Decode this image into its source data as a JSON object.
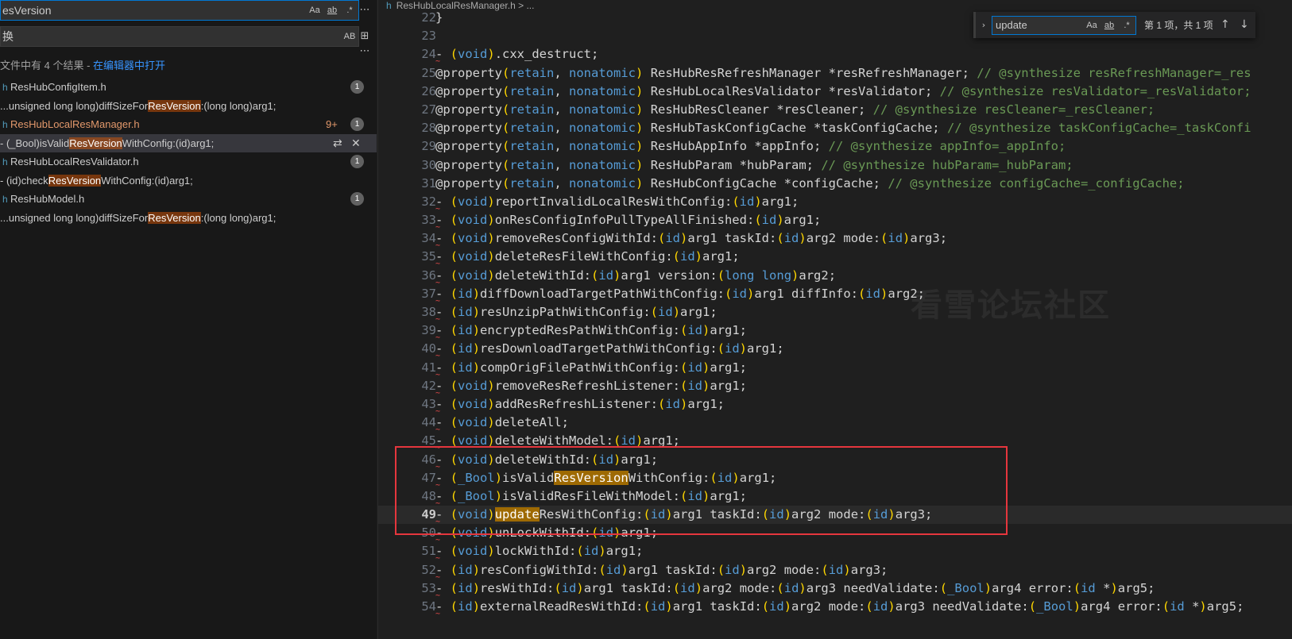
{
  "search": {
    "query": "esVersion",
    "replace_placeholder": "换",
    "opt_case": "Aa",
    "opt_word": "ab",
    "opt_regex": ".*",
    "opt_preserve_case": "AB",
    "summary_prefix": "文件中有 4 个结果 - ",
    "summary_link": "在编辑器中打开",
    "results": [
      {
        "file": "ResHubConfigItem.h",
        "count": "1",
        "matches": [
          {
            "before": "...unsigned long long)diffSizeFor",
            "match": "ResVersion",
            "after": ":(long long)arg1;"
          }
        ]
      },
      {
        "file": "ResHubLocalResManager.h",
        "count": "1",
        "modified": "9+",
        "matches": [
          {
            "before": "- (_Bool)isValid",
            "match": "ResVersion",
            "after": "WithConfig:(id)arg1;"
          }
        ]
      },
      {
        "file": "ResHubLocalResValidator.h",
        "count": "1",
        "matches": [
          {
            "before": "- (id)check",
            "match": "ResVersion",
            "after": "WithConfig:(id)arg1;"
          }
        ]
      },
      {
        "file": "ResHubModel.h",
        "count": "1",
        "matches": [
          {
            "before": "...unsigned long long)diffSizeFor",
            "match": "ResVersion",
            "after": ":(long long)arg1;"
          }
        ]
      }
    ]
  },
  "editor": {
    "breadcrumb_file": "ResHubLocalResManager.h",
    "breadcrumb_rest": " > ...",
    "find": {
      "query": "update",
      "count": "第 1 项，共 1 项",
      "opt_case": "Aa",
      "opt_word": "ab",
      "opt_regex": ".*"
    },
    "lines": [
      {
        "n": "22",
        "text": "}"
      },
      {
        "n": "23",
        "text": ""
      },
      {
        "n": "24",
        "text": "- (void).cxx_destruct;"
      },
      {
        "n": "25",
        "text": "@property(retain, nonatomic) ResHubResRefreshManager *resRefreshManager; // @synthesize resRefreshManager=_res"
      },
      {
        "n": "26",
        "text": "@property(retain, nonatomic) ResHubLocalResValidator *resValidator; // @synthesize resValidator=_resValidator;"
      },
      {
        "n": "27",
        "text": "@property(retain, nonatomic) ResHubResCleaner *resCleaner; // @synthesize resCleaner=_resCleaner;"
      },
      {
        "n": "28",
        "text": "@property(retain, nonatomic) ResHubTaskConfigCache *taskConfigCache; // @synthesize taskConfigCache=_taskConfi"
      },
      {
        "n": "29",
        "text": "@property(retain, nonatomic) ResHubAppInfo *appInfo; // @synthesize appInfo=_appInfo;"
      },
      {
        "n": "30",
        "text": "@property(retain, nonatomic) ResHubParam *hubParam; // @synthesize hubParam=_hubParam;"
      },
      {
        "n": "31",
        "text": "@property(retain, nonatomic) ResHubConfigCache *configCache; // @synthesize configCache=_configCache;"
      },
      {
        "n": "32",
        "text": "- (void)reportInvalidLocalResWithConfig:(id)arg1;"
      },
      {
        "n": "33",
        "text": "- (void)onResConfigInfoPullTypeAllFinished:(id)arg1;"
      },
      {
        "n": "34",
        "text": "- (void)removeResConfigWithId:(id)arg1 taskId:(id)arg2 mode:(id)arg3;"
      },
      {
        "n": "35",
        "text": "- (void)deleteResFileWithConfig:(id)arg1;"
      },
      {
        "n": "36",
        "text": "- (void)deleteWithId:(id)arg1 version:(long long)arg2;"
      },
      {
        "n": "37",
        "text": "- (id)diffDownloadTargetPathWithConfig:(id)arg1 diffInfo:(id)arg2;"
      },
      {
        "n": "38",
        "text": "- (id)resUnzipPathWithConfig:(id)arg1;"
      },
      {
        "n": "39",
        "text": "- (id)encryptedResPathWithConfig:(id)arg1;"
      },
      {
        "n": "40",
        "text": "- (id)resDownloadTargetPathWithConfig:(id)arg1;"
      },
      {
        "n": "41",
        "text": "- (id)compOrigFilePathWithConfig:(id)arg1;"
      },
      {
        "n": "42",
        "text": "- (void)removeResRefreshListener:(id)arg1;"
      },
      {
        "n": "43",
        "text": "- (void)addResRefreshListener:(id)arg1;"
      },
      {
        "n": "44",
        "text": "- (void)deleteAll;"
      },
      {
        "n": "45",
        "text": "- (void)deleteWithModel:(id)arg1;"
      },
      {
        "n": "46",
        "text": "- (void)deleteWithId:(id)arg1;"
      },
      {
        "n": "47",
        "text": "- (_Bool)isValidResVersionWithConfig:(id)arg1;"
      },
      {
        "n": "48",
        "text": "- (_Bool)isValidResFileWithModel:(id)arg1;"
      },
      {
        "n": "49",
        "text": "- (void)updateResWithConfig:(id)arg1 taskId:(id)arg2 mode:(id)arg3;"
      },
      {
        "n": "50",
        "text": "- (void)unLockWithId:(id)arg1;"
      },
      {
        "n": "51",
        "text": "- (void)lockWithId:(id)arg1;"
      },
      {
        "n": "52",
        "text": "- (id)resConfigWithId:(id)arg1 taskId:(id)arg2 mode:(id)arg3;"
      },
      {
        "n": "53",
        "text": "- (id)resWithId:(id)arg1 taskId:(id)arg2 mode:(id)arg3 needValidate:(_Bool)arg4 error:(id *)arg5;"
      },
      {
        "n": "54",
        "text": "- (id)externalReadResWithId:(id)arg1 taskId:(id)arg2 mode:(id)arg3 needValidate:(_Bool)arg4 error:(id *)arg5;"
      }
    ],
    "current_line": "49",
    "highlight_words": [
      "ResVersion",
      "update"
    ]
  },
  "watermark": "看雪论坛社区",
  "colors": {
    "accent": "#0078d4",
    "match": "#9e6a03",
    "modified": "#e2986b",
    "annotation": "#e5363d"
  }
}
